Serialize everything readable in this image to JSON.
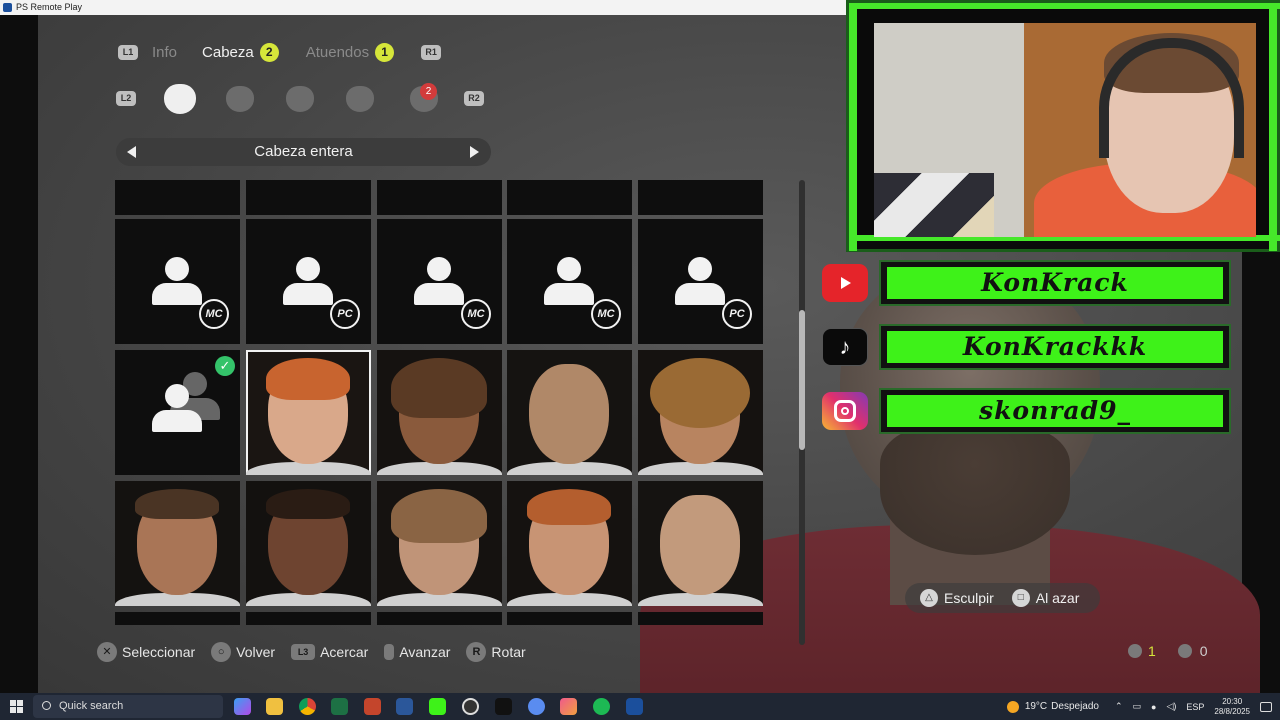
{
  "window": {
    "title": "PS Remote Play"
  },
  "tabs": {
    "prev_button": "L1",
    "next_button": "R1",
    "items": [
      {
        "label": "Info",
        "badge": null
      },
      {
        "label": "Cabeza",
        "badge": "2"
      },
      {
        "label": "Atuendos",
        "badge": "1"
      }
    ]
  },
  "subtabs": {
    "prev_button": "L2",
    "next_button": "R2",
    "notification_badge": "2"
  },
  "selector": {
    "label": "Cabeza entera"
  },
  "grid": {
    "generic_tags": [
      "MC",
      "PC",
      "MC",
      "MC",
      "PC"
    ]
  },
  "hints": {
    "select": "Seleccionar",
    "back": "Volver",
    "zoom": "Acercar",
    "advance": "Avanzar",
    "rotate": "Rotar",
    "rotate_btn": "R"
  },
  "actions": {
    "sculpt": "Esculpir",
    "random": "Al azar"
  },
  "counts": {
    "likes": "1",
    "users": "0"
  },
  "social": {
    "youtube": "KonKrack",
    "tiktok": "KonKrackkk",
    "instagram": "skonrad9_"
  },
  "taskbar": {
    "search_placeholder": "Quick search",
    "weather_temp": "19°C",
    "weather_text": "Despejado",
    "language": "ESP",
    "time": "20:30",
    "date": "28/8/2025"
  },
  "colors": {
    "accent_yellow": "#d6e63a",
    "neon_green": "#3ef219",
    "selected_check": "#34c36a"
  }
}
